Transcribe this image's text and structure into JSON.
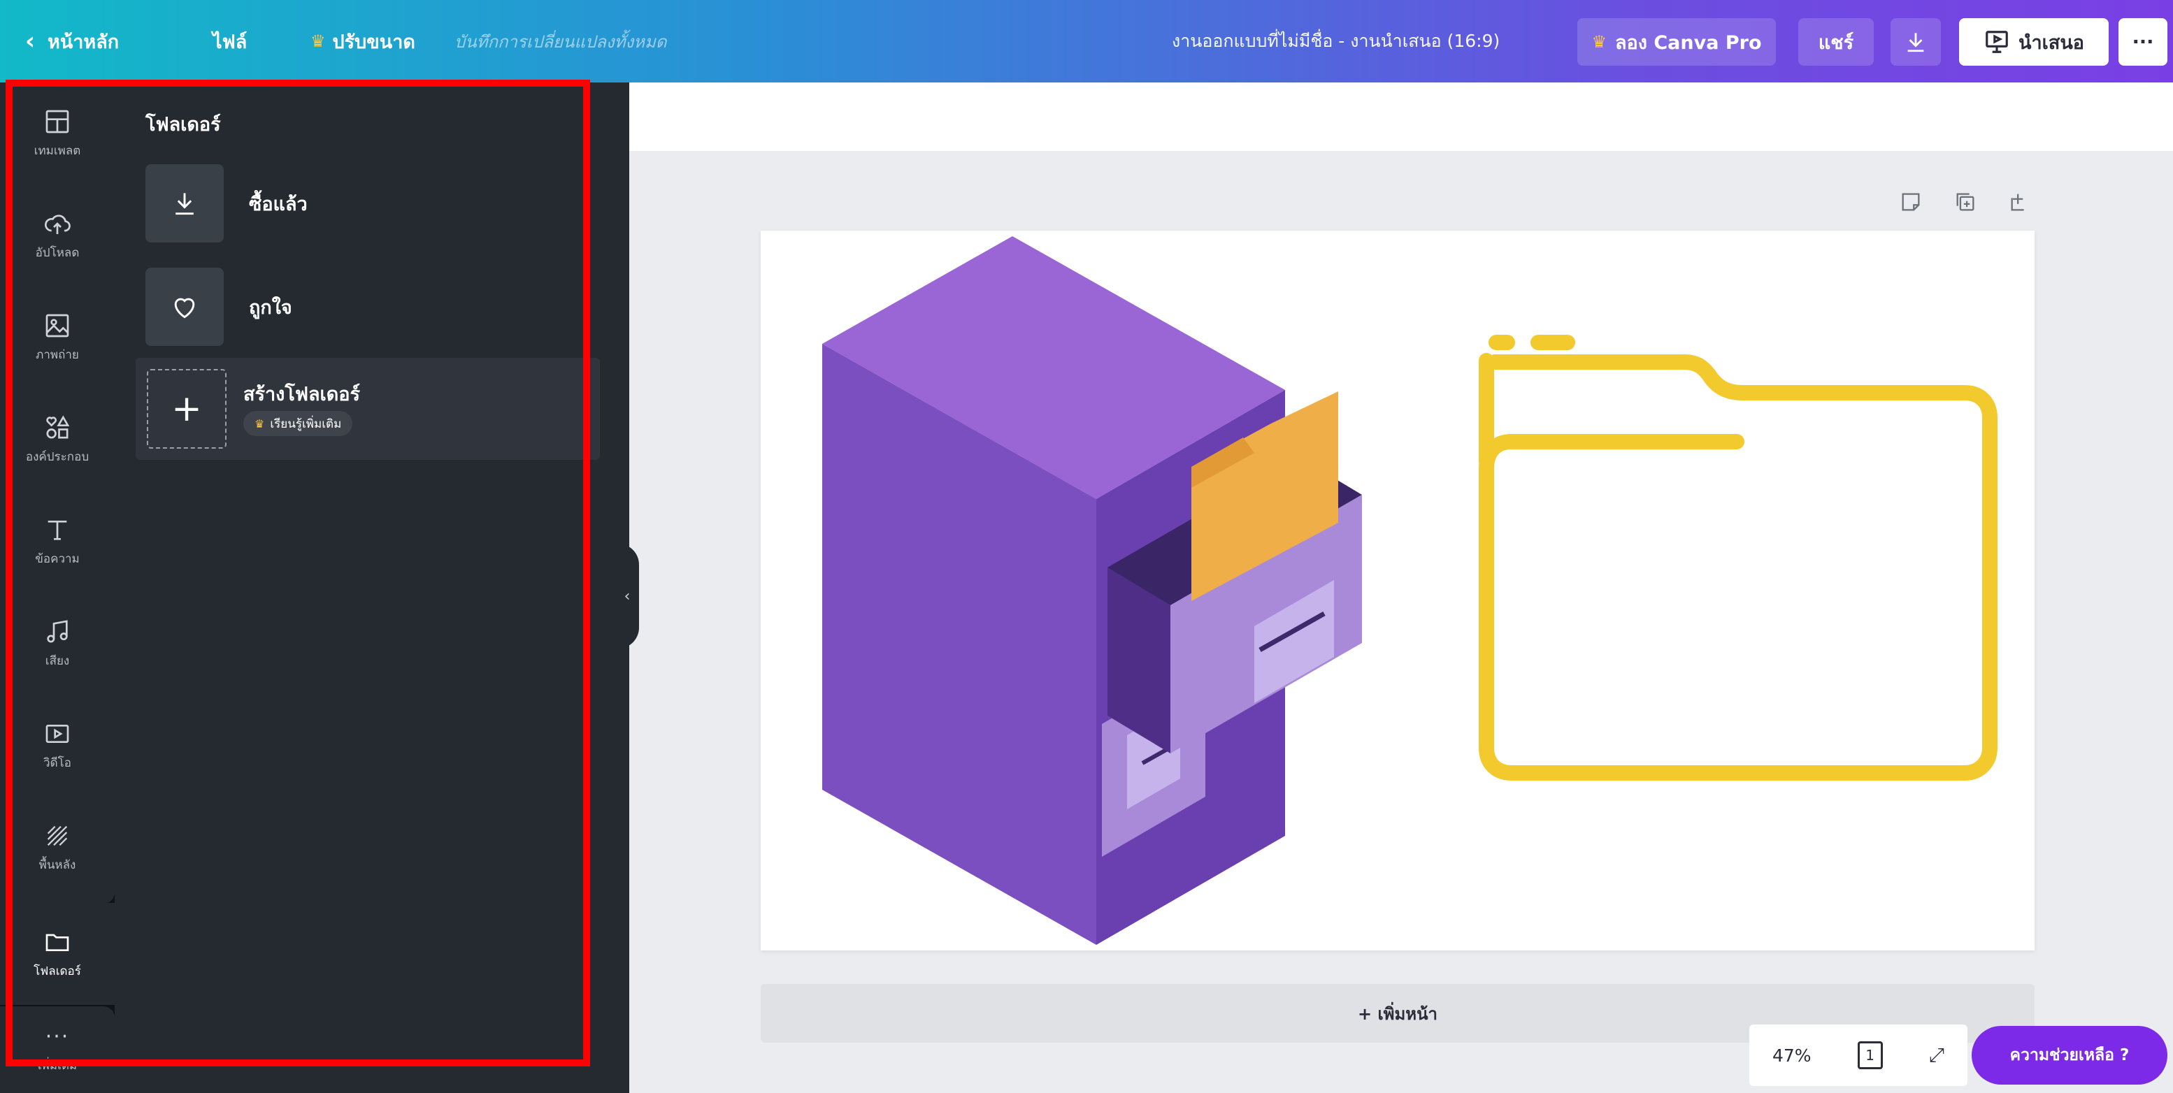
{
  "topbar": {
    "back_label": "หน้าหลัก",
    "file_label": "ไฟล์",
    "resize_label": "ปรับขนาด",
    "save_status": "บันทึกการเปลี่ยนแปลงทั้งหมด",
    "doc_title": "งานออกแบบที่ไม่มีชื่อ - งานนำเสนอ (16:9)",
    "try_pro_label": "ลอง Canva Pro",
    "share_label": "แชร์",
    "present_label": "นำเสนอ",
    "more_label": "···"
  },
  "rail": {
    "items": [
      {
        "label": "เทมเพลต",
        "icon": "template-icon"
      },
      {
        "label": "อัปโหลด",
        "icon": "upload-cloud-icon"
      },
      {
        "label": "ภาพถ่าย",
        "icon": "photo-icon"
      },
      {
        "label": "องค์ประกอบ",
        "icon": "elements-icon"
      },
      {
        "label": "ข้อความ",
        "icon": "text-icon"
      },
      {
        "label": "เสียง",
        "icon": "music-icon"
      },
      {
        "label": "วิดีโอ",
        "icon": "video-icon"
      },
      {
        "label": "พื้นหลัง",
        "icon": "background-icon"
      },
      {
        "label": "โฟลเดอร์",
        "icon": "folder-icon"
      }
    ],
    "more_label": "เพิ่มเติม"
  },
  "panel": {
    "title": "โฟลเดอร์",
    "purchased_label": "ซื้อแล้ว",
    "liked_label": "ถูกใจ",
    "create_label": "สร้างโฟลเดอร์",
    "pro_badge": "เรียนรู้เพิ่มเติม"
  },
  "canvas": {
    "add_page_label": "+ เพิ่มหน้า",
    "zoom": "47%",
    "page_count": "1",
    "help_label": "ความช่วยเหลือ ?"
  },
  "colors": {
    "accent_purple": "#7d2ae8",
    "highlight_red": "#ff0000",
    "folder_yellow": "#f2ca2e",
    "cabinet_purple": "#8a5ccb"
  }
}
